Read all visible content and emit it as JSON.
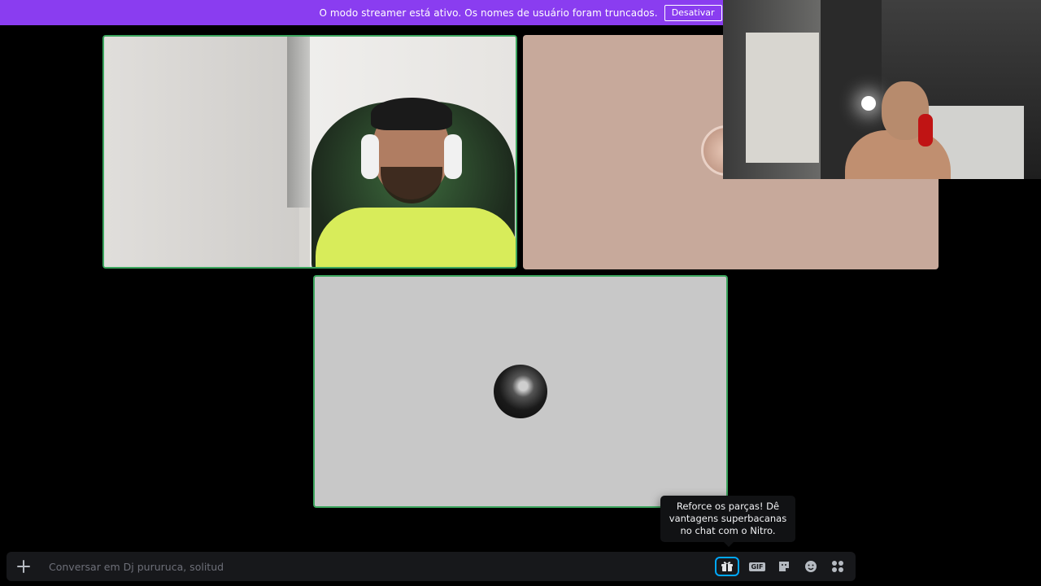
{
  "banner": {
    "text": "O modo streamer está ativo. Os nomes de usuário foram truncados.",
    "button_label": "Desativar"
  },
  "tooltip": {
    "text": "Reforce os parças! Dê vantagens superbacanas no chat com o Nitro."
  },
  "chat": {
    "placeholder": "Conversar em Dj pururuca, solitud",
    "plus_icon": "plus-circle-icon",
    "icons": [
      "gift-icon",
      "gif-icon",
      "sticker-icon",
      "emoji-icon",
      "apps-icon"
    ]
  },
  "colors": {
    "banner": "#8a3df0",
    "speaking_border": "#3ba55d",
    "gift_focus": "#00a8fc"
  }
}
